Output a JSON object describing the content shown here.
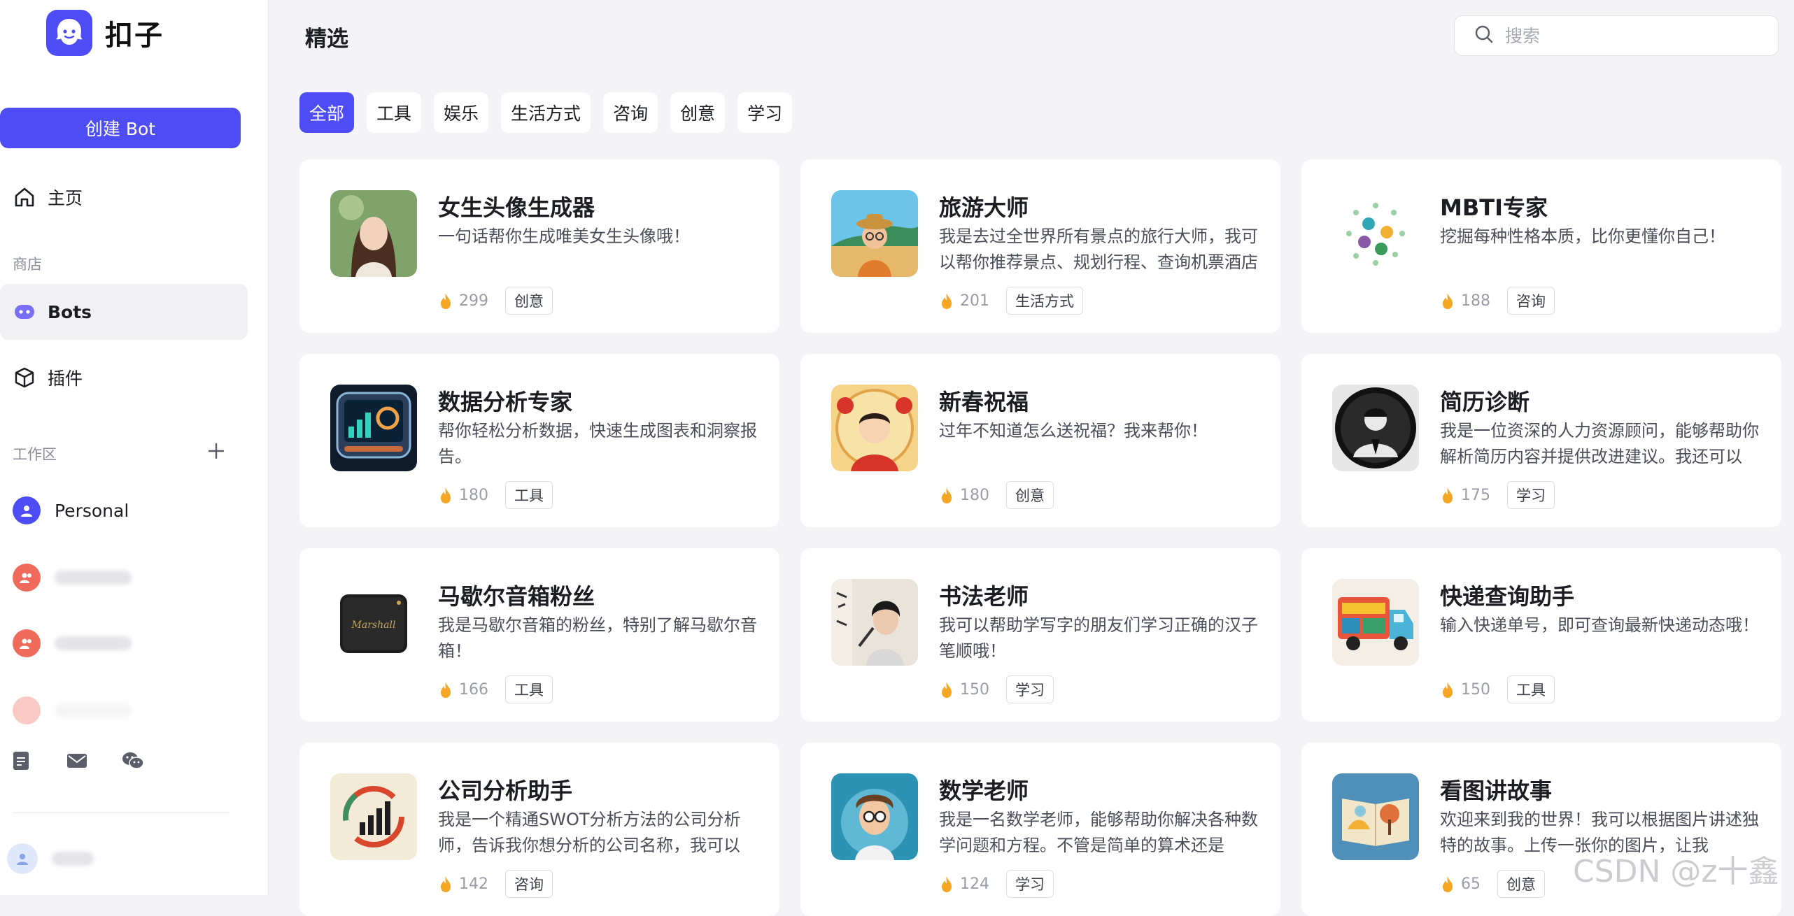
{
  "app": {
    "name": "扣子",
    "brand_color": "#4e4df5"
  },
  "sidebar": {
    "create_label": "创建 Bot",
    "home_label": "主页",
    "store_section": "商店",
    "bots_label": "Bots",
    "plugins_label": "插件",
    "workspace_section": "工作区",
    "workspace_personal": "Personal"
  },
  "header": {
    "title": "精选",
    "search_placeholder": "搜索"
  },
  "tabs": [
    "全部",
    "工具",
    "娱乐",
    "生活方式",
    "咨询",
    "创意",
    "学习"
  ],
  "active_tab": "全部",
  "cards": [
    {
      "name": "女生头像生成器",
      "desc": "一句话帮你生成唯美女生头像哦！",
      "count": "299",
      "tag": "创意",
      "icon": "girl-portrait-icon"
    },
    {
      "name": "旅游大师",
      "desc": "我是去过全世界所有景点的旅行大师，我可以帮你推荐景点、规划行程、查询机票酒店",
      "count": "201",
      "tag": "生活方式",
      "icon": "traveler-icon"
    },
    {
      "name": "MBTI专家",
      "desc": "挖掘每种性格本质，比你更懂你自己！",
      "count": "188",
      "tag": "咨询",
      "icon": "mbti-dots-icon"
    },
    {
      "name": "数据分析专家",
      "desc": "帮你轻松分析数据，快速生成图表和洞察报告。",
      "count": "180",
      "tag": "工具",
      "icon": "data-dashboard-icon"
    },
    {
      "name": "新春祝福",
      "desc": "过年不知道怎么送祝福？我来帮你！",
      "count": "180",
      "tag": "创意",
      "icon": "new-year-boy-icon"
    },
    {
      "name": "简历诊断",
      "desc": "我是一位资深的人力资源顾问，能够帮助你解析简历内容并提供改进建议。我还可以",
      "count": "175",
      "tag": "学习",
      "icon": "hr-advisor-icon"
    },
    {
      "name": "马歇尔音箱粉丝",
      "desc": "我是马歇尔音箱的粉丝，特别了解马歇尔音箱！",
      "count": "166",
      "tag": "工具",
      "icon": "speaker-icon"
    },
    {
      "name": "书法老师",
      "desc": "我可以帮助学写字的朋友们学习正确的汉子笔顺哦！",
      "count": "150",
      "tag": "学习",
      "icon": "calligraphy-teacher-icon"
    },
    {
      "name": "快递查询助手",
      "desc": "输入快递单号，即可查询最新快递动态哦！",
      "count": "150",
      "tag": "工具",
      "icon": "delivery-truck-icon"
    },
    {
      "name": "公司分析助手",
      "desc": "我是一个精通SWOT分析方法的公司分析师，告诉我你想分析的公司名称，我可以",
      "count": "142",
      "tag": "咨询",
      "icon": "company-chart-icon"
    },
    {
      "name": "数学老师",
      "desc": "我是一名数学老师，能够帮助你解决各种数学问题和方程。不管是简单的算术还是",
      "count": "124",
      "tag": "学习",
      "icon": "math-teacher-icon"
    },
    {
      "name": "看图讲故事",
      "desc": "欢迎来到我的世界！我可以根据图片讲述独特的故事。上传一张你的图片，让我",
      "count": "65",
      "tag": "创意",
      "icon": "storybook-icon"
    }
  ],
  "watermark": "CSDN @z十鑫"
}
